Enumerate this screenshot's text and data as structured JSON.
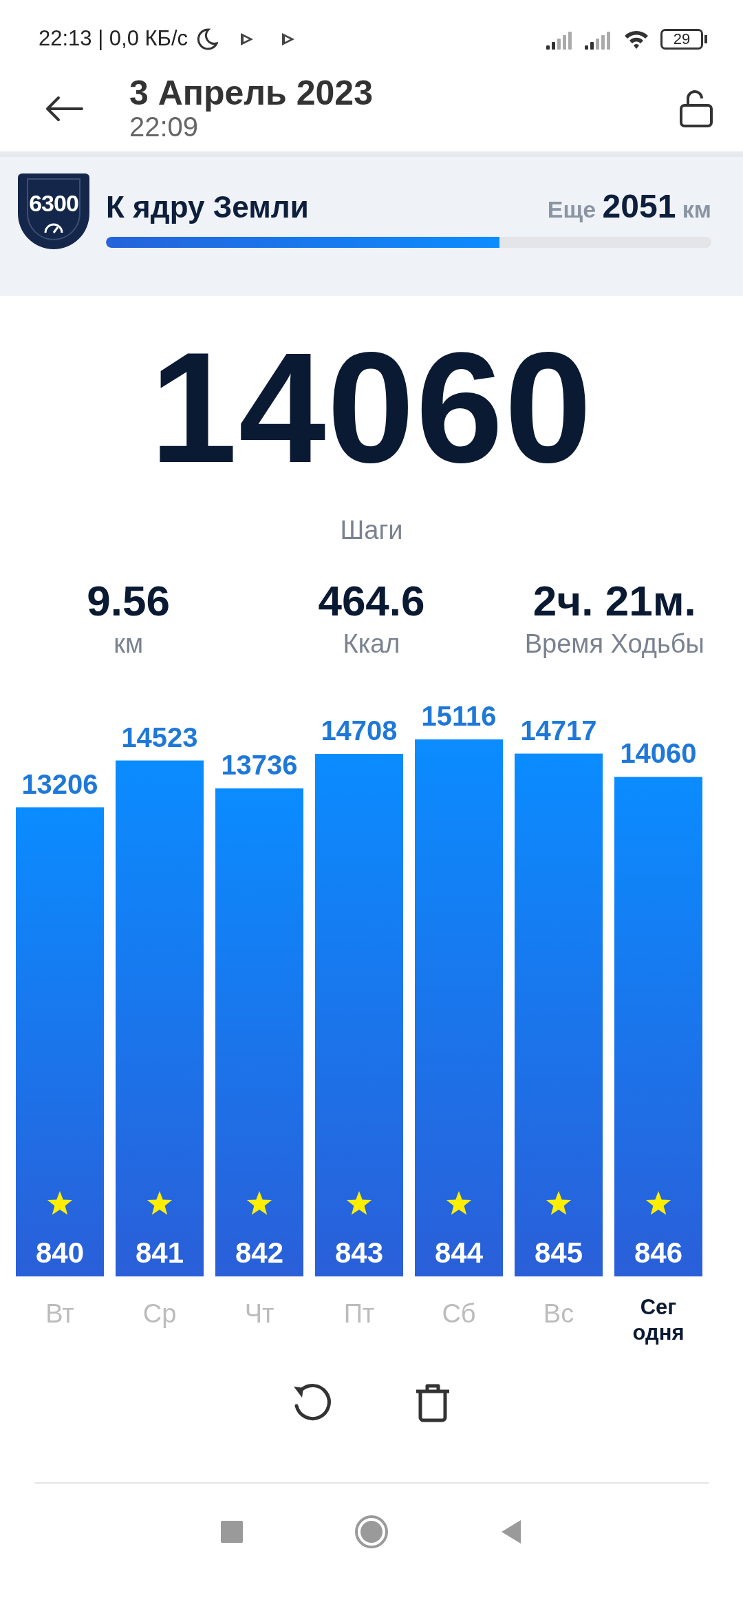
{
  "status_bar": {
    "time": "22:13 | 0,0 КБ/с",
    "battery": "29"
  },
  "header": {
    "title": "3 Апрель 2023",
    "subtitle": "22:09"
  },
  "goal": {
    "badge": "6300",
    "title": "К ядру Земли",
    "remaining": "Еще **2051** км",
    "level": 0.65
  },
  "steps": {
    "value": "14060",
    "label": "Шаги"
  },
  "stats": [
    {
      "value": "9.56",
      "label": "км"
    },
    {
      "value": "464.6",
      "label": "Ккал"
    },
    {
      "value": "2ч. 21м.",
      "label": "Время Ходьбы"
    }
  ],
  "chart_data": {
    "type": "bar",
    "categories": [
      "Вт",
      "Ср",
      "Чт",
      "Пт",
      "Сб",
      "Вс",
      "Сег одня"
    ],
    "values": [
      13206,
      14523,
      13736,
      14708,
      15116,
      14717,
      14060
    ],
    "data_labels": true
  },
  "bars": [
    {
      "star_label": "840",
      "selected": false
    },
    {
      "star_label": "841",
      "selected": false
    },
    {
      "star_label": "842",
      "selected": false
    },
    {
      "star_label": "843",
      "selected": false
    },
    {
      "star_label": "844",
      "selected": false
    },
    {
      "star_label": "845",
      "selected": false
    },
    {
      "star_label": "846",
      "selected": true
    }
  ]
}
